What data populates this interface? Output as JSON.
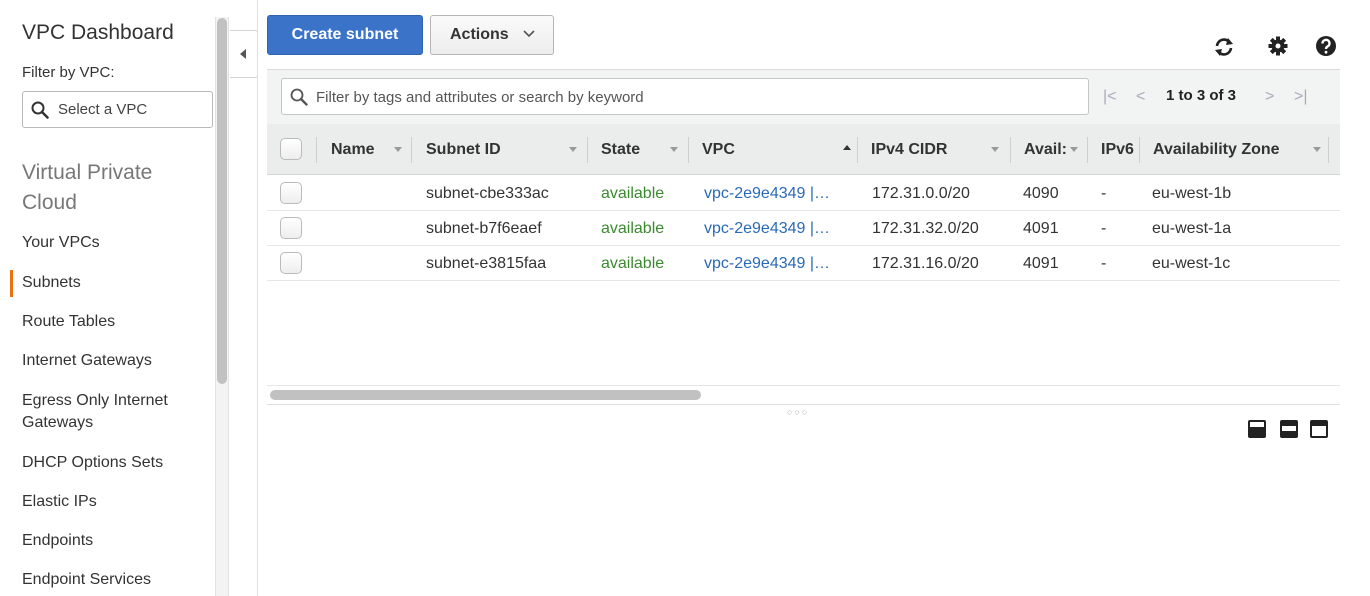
{
  "sidebar": {
    "title": "VPC Dashboard",
    "filter_label": "Filter by VPC:",
    "select_placeholder": "Select a VPC",
    "section_title": "Virtual Private Cloud",
    "items": [
      {
        "label": "Your VPCs"
      },
      {
        "label": "Subnets"
      },
      {
        "label": "Route Tables"
      },
      {
        "label": "Internet Gateways"
      },
      {
        "label": "Egress Only Internet Gateways"
      },
      {
        "label": "DHCP Options Sets"
      },
      {
        "label": "Elastic IPs"
      },
      {
        "label": "Endpoints"
      },
      {
        "label": "Endpoint Services"
      }
    ],
    "active_item": "Subnets",
    "accent_color": "#ec7211"
  },
  "toolbar": {
    "create_label": "Create subnet",
    "actions_label": "Actions",
    "icons": [
      "refresh-icon",
      "gear-icon",
      "help-icon"
    ]
  },
  "filter": {
    "placeholder": "Filter by tags and attributes or search by keyword",
    "pager_text": "1 to 3 of 3"
  },
  "table": {
    "columns": [
      "Name",
      "Subnet ID",
      "State",
      "VPC",
      "IPv4 CIDR",
      "Avail:",
      "IPv6",
      "Availability Zone"
    ],
    "rows": [
      {
        "name": "",
        "subnet_id": "subnet-cbe333ac",
        "state": "available",
        "vpc": "vpc-2e9e4349 |…",
        "cidr": "172.31.0.0/20",
        "avail": "4090",
        "ipv6": "-",
        "az": "eu-west-1b"
      },
      {
        "name": "",
        "subnet_id": "subnet-b7f6eaef",
        "state": "available",
        "vpc": "vpc-2e9e4349 |…",
        "cidr": "172.31.32.0/20",
        "avail": "4091",
        "ipv6": "-",
        "az": "eu-west-1a"
      },
      {
        "name": "",
        "subnet_id": "subnet-e3815faa",
        "state": "available",
        "vpc": "vpc-2e9e4349 |…",
        "cidr": "172.31.16.0/20",
        "avail": "4091",
        "ipv6": "-",
        "az": "eu-west-1c"
      }
    ]
  },
  "colors": {
    "primary_button": "#3b73c9",
    "state_available": "#3a8a2e",
    "link": "#2a69b8"
  }
}
